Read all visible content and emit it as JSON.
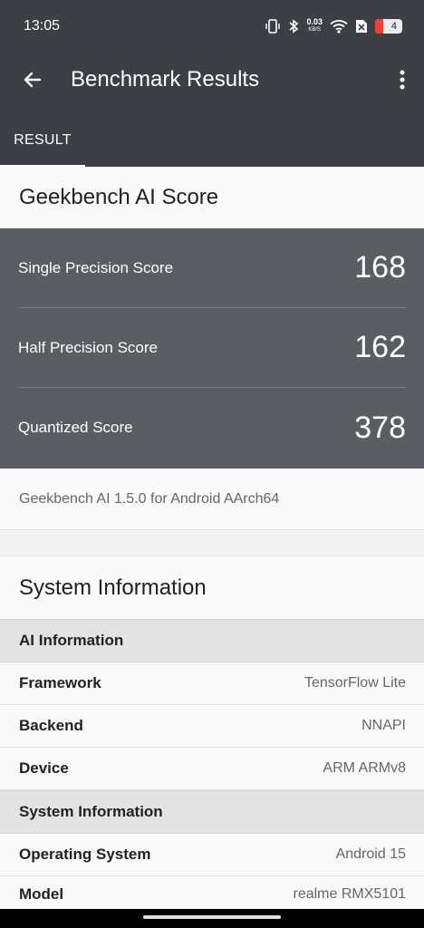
{
  "status_bar": {
    "time": "13:05",
    "net_speed": "0.03",
    "net_unit": "KB/S",
    "battery": "4",
    "icons": [
      "vibrate-icon",
      "bluetooth-icon",
      "wifi-icon",
      "sim-off-icon",
      "battery-icon"
    ]
  },
  "toolbar": {
    "title": "Benchmark Results",
    "back_icon": "arrow-left-icon",
    "menu_icon": "more-vertical-icon"
  },
  "tabs": [
    {
      "label": "RESULT",
      "selected": true
    }
  ],
  "score_section": {
    "title": "Geekbench AI Score",
    "scores": [
      {
        "label": "Single Precision Score",
        "value": "168"
      },
      {
        "label": "Half Precision Score",
        "value": "162"
      },
      {
        "label": "Quantized Score",
        "value": "378"
      }
    ],
    "version": "Geekbench AI 1.5.0 for Android AArch64"
  },
  "system_section": {
    "title": "System Information",
    "groups": [
      {
        "title": "AI Information",
        "rows": [
          {
            "key": "Framework",
            "value": "TensorFlow Lite"
          },
          {
            "key": "Backend",
            "value": "NNAPI"
          },
          {
            "key": "Device",
            "value": "ARM ARMv8"
          }
        ]
      },
      {
        "title": "System Information",
        "rows": [
          {
            "key": "Operating System",
            "value": "Android 15"
          },
          {
            "key": "Model",
            "value": "realme RMX5101"
          }
        ]
      }
    ]
  },
  "colors": {
    "appbar": "#3d3f44",
    "score_panel": "#5c5d63",
    "group_header": "#e3e3e3",
    "background": "#f2f2f2"
  }
}
